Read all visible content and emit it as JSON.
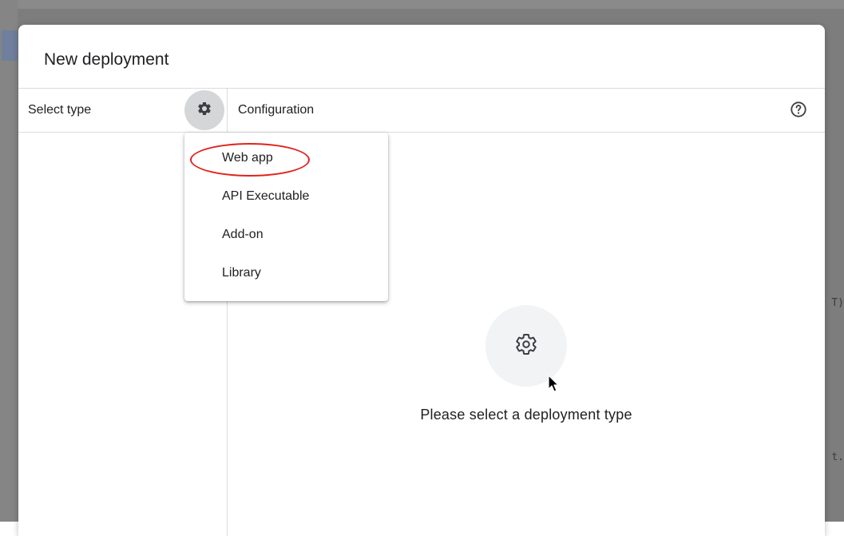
{
  "dialog": {
    "title": "New deployment"
  },
  "left_panel": {
    "header_label": "Select type",
    "gear_icon": "gear-icon"
  },
  "right_panel": {
    "header_label": "Configuration",
    "help_icon": "help-circle-icon",
    "empty_state": {
      "icon": "gear-icon",
      "message": "Please select a deployment type"
    }
  },
  "type_menu": {
    "items": [
      {
        "label": "Web app"
      },
      {
        "label": "API Executable"
      },
      {
        "label": "Add-on"
      },
      {
        "label": "Library"
      }
    ]
  },
  "background": {
    "code_fragments": [
      "T)",
      "t."
    ]
  },
  "colors": {
    "annotation_red": "#e0231d",
    "text": "#202124",
    "divider": "#dadce0"
  }
}
